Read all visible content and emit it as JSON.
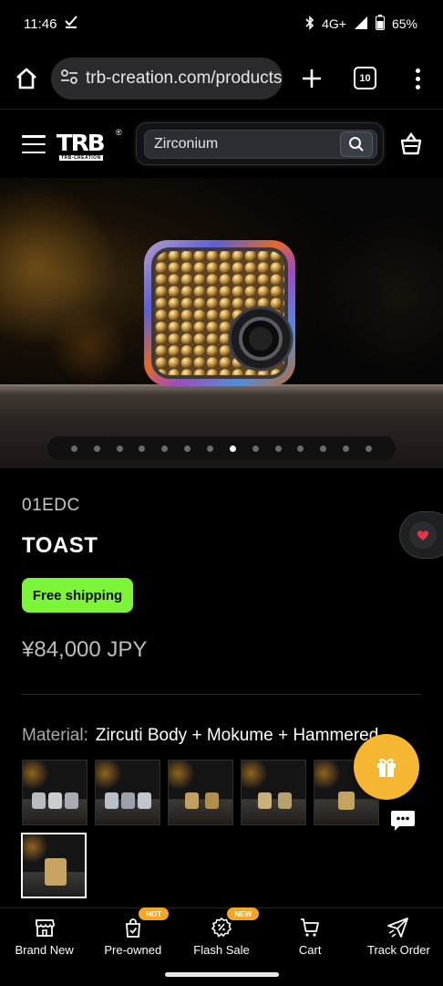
{
  "status_bar": {
    "time": "11:46",
    "network": "4G+",
    "battery": "65%",
    "icons": [
      "download-done-icon",
      "bluetooth-icon",
      "signal-icon",
      "battery-icon"
    ]
  },
  "browser": {
    "url": "trb-creation.com/products",
    "tab_count": "10",
    "icons": [
      "home-icon",
      "site-settings-icon",
      "new-tab-icon",
      "tabs-icon",
      "more-menu-icon"
    ]
  },
  "site_header": {
    "logo_text": "TRB",
    "logo_sub": "TRB-CREATION",
    "logo_reg": "®",
    "search_value": "Zirconium",
    "icons": [
      "hamburger-icon",
      "search-icon",
      "basket-icon"
    ]
  },
  "hero": {
    "slide_count": 14,
    "active_slide": 8
  },
  "product": {
    "vendor": "01EDC",
    "title": "TOAST",
    "shipping_badge": "Free shipping",
    "price": "¥84,000 JPY",
    "material_label": "Material:",
    "material_value": "Zircuti Body + Mokume + Hammered"
  },
  "swatches": [
    {
      "id": 1,
      "selected": false
    },
    {
      "id": 2,
      "selected": false
    },
    {
      "id": 3,
      "selected": false
    },
    {
      "id": 4,
      "selected": false
    },
    {
      "id": 5,
      "selected": false
    },
    {
      "id": 6,
      "selected": true
    }
  ],
  "floating": {
    "icons": [
      "heart-icon",
      "gift-icon",
      "chat-icon"
    ]
  },
  "bottom_nav": {
    "items": [
      {
        "label": "Brand New",
        "icon": "store-icon",
        "badge": ""
      },
      {
        "label": "Pre-owned",
        "icon": "tag-bag-icon",
        "badge": "HOT"
      },
      {
        "label": "Flash Sale",
        "icon": "discount-icon",
        "badge": "NEW"
      },
      {
        "label": "Cart",
        "icon": "cart-icon",
        "badge": ""
      },
      {
        "label": "Track Order",
        "icon": "track-plane-icon",
        "badge": ""
      }
    ]
  },
  "colors": {
    "shipping_green": "#7cf438",
    "gift_yellow": "#f5b731",
    "badge_orange": "#f5a623"
  }
}
